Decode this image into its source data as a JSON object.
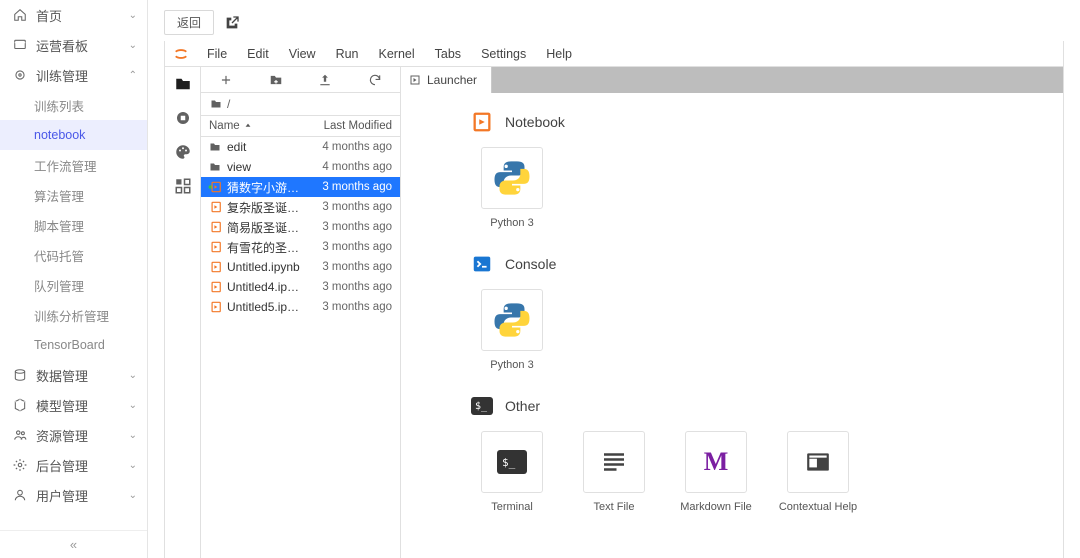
{
  "sidebar": {
    "items": [
      {
        "label": "首页",
        "icon": "home",
        "expandable": true,
        "open": false
      },
      {
        "label": "运营看板",
        "icon": "dashboard",
        "expandable": true,
        "open": false
      },
      {
        "label": "训练管理",
        "icon": "settings-ring",
        "expandable": true,
        "open": true,
        "children": [
          {
            "label": "训练列表"
          },
          {
            "label": "notebook",
            "active": true
          },
          {
            "label": "工作流管理"
          },
          {
            "label": "算法管理"
          },
          {
            "label": "脚本管理"
          },
          {
            "label": "代码托管"
          },
          {
            "label": "队列管理"
          },
          {
            "label": "训练分析管理"
          },
          {
            "label": "TensorBoard"
          }
        ]
      },
      {
        "label": "数据管理",
        "icon": "database",
        "expandable": true,
        "open": false
      },
      {
        "label": "模型管理",
        "icon": "cube",
        "expandable": true,
        "open": false
      },
      {
        "label": "资源管理",
        "icon": "people",
        "expandable": true,
        "open": false
      },
      {
        "label": "后台管理",
        "icon": "gear",
        "expandable": true,
        "open": false
      },
      {
        "label": "用户管理",
        "icon": "user",
        "expandable": true,
        "open": false
      }
    ]
  },
  "topbar": {
    "back": "返回"
  },
  "jupyter": {
    "menu": [
      "File",
      "Edit",
      "View",
      "Run",
      "Kernel",
      "Tabs",
      "Settings",
      "Help"
    ],
    "activity": [
      "folder",
      "running",
      "palette",
      "extensions"
    ],
    "filebrowser": {
      "crumb": "/",
      "headers": {
        "name": "Name",
        "modified": "Last Modified"
      },
      "files": [
        {
          "name": "edit",
          "type": "folder",
          "modified": "4 months ago"
        },
        {
          "name": "view",
          "type": "folder",
          "modified": "4 months ago"
        },
        {
          "name": "猜数字小游…",
          "type": "notebook",
          "modified": "3 months ago",
          "selected": true,
          "running": true
        },
        {
          "name": "复杂版圣诞…",
          "type": "notebook",
          "modified": "3 months ago"
        },
        {
          "name": "简易版圣诞…",
          "type": "notebook",
          "modified": "3 months ago"
        },
        {
          "name": "有雪花的圣…",
          "type": "notebook",
          "modified": "3 months ago"
        },
        {
          "name": "Untitled.ipynb",
          "type": "notebook",
          "modified": "3 months ago"
        },
        {
          "name": "Untitled4.ip…",
          "type": "notebook",
          "modified": "3 months ago"
        },
        {
          "name": "Untitled5.ip…",
          "type": "notebook",
          "modified": "3 months ago"
        }
      ]
    },
    "tab": {
      "title": "Launcher"
    },
    "launcher": {
      "sections": [
        {
          "title": "Notebook",
          "icon": "notebook-orange",
          "cards": [
            {
              "label": "Python 3",
              "icon": "python"
            }
          ]
        },
        {
          "title": "Console",
          "icon": "console-blue",
          "cards": [
            {
              "label": "Python 3",
              "icon": "python"
            }
          ]
        },
        {
          "title": "Other",
          "icon": "terminal-dark",
          "cards": [
            {
              "label": "Terminal",
              "icon": "terminal"
            },
            {
              "label": "Text File",
              "icon": "textfile"
            },
            {
              "label": "Markdown File",
              "icon": "markdown"
            },
            {
              "label": "Contextual Help",
              "icon": "helpbox"
            }
          ]
        }
      ]
    }
  }
}
